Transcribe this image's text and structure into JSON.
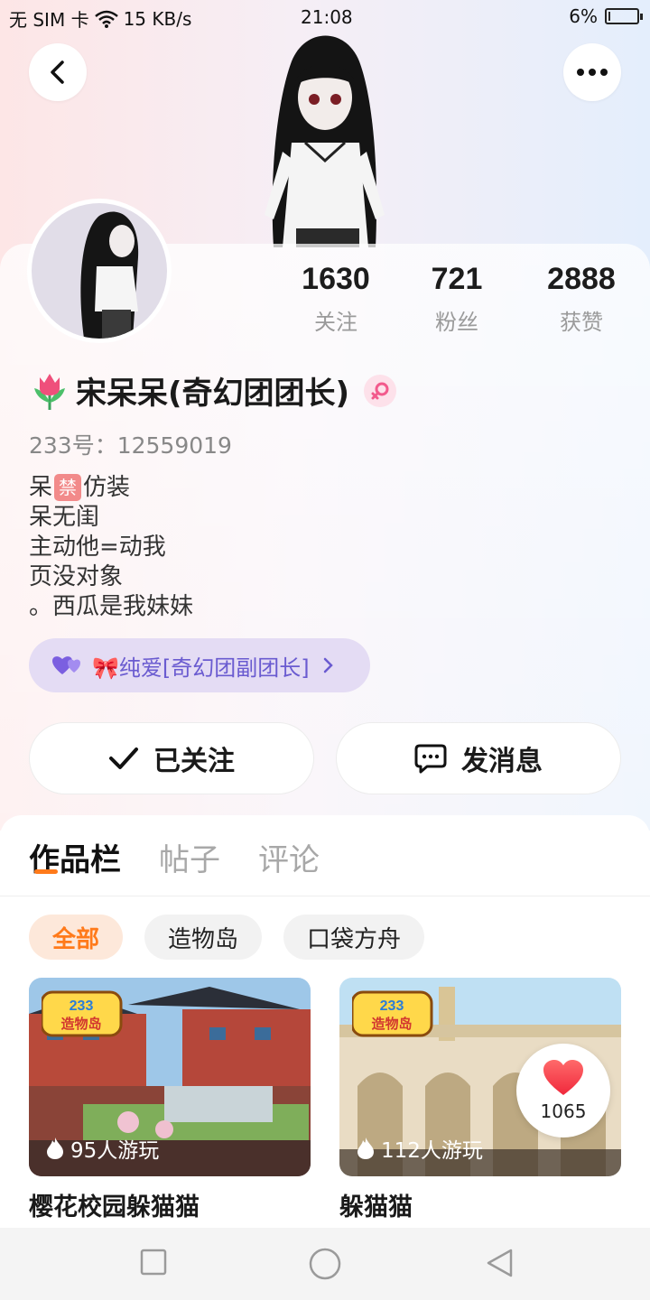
{
  "status_bar": {
    "sim": "无 SIM 卡",
    "net_speed": "15 KB/s",
    "time": "21:08",
    "battery": "6%",
    "battery_level": 0.06
  },
  "profile": {
    "stats": [
      {
        "value": "1630",
        "label": "关注"
      },
      {
        "value": "721",
        "label": "粉丝"
      },
      {
        "value": "2888",
        "label": "获赞"
      }
    ],
    "name": "宋呆呆(奇幻团团长)",
    "uid": "233号：12559019",
    "bio": {
      "line1_prefix": "呆",
      "line1_banned": "禁",
      "line1_suffix": "仿装",
      "line2": "呆无闺",
      "line3": "主动他=动我",
      "line4": "页没对象",
      "line5": "。西瓜是我妹妹"
    },
    "cp_label": "🎀纯爱[奇幻团副团长]"
  },
  "actions": {
    "follow_label": "已关注",
    "message_label": "发消息"
  },
  "tabs": [
    "作品栏",
    "帖子",
    "评论"
  ],
  "filters": [
    "全部",
    "造物岛",
    "口袋方舟"
  ],
  "works": [
    {
      "title": "樱花校园躲猫猫",
      "plays": "95人游玩",
      "badge": "造物岛"
    },
    {
      "title": "躲猫猫",
      "plays": "112人游玩",
      "badge": "造物岛"
    }
  ],
  "like_bubble": {
    "count": "1065"
  },
  "colors": {
    "accent": "#ff7a1a",
    "cp_text": "#6a5bd0",
    "like": "#ff3b4f"
  }
}
